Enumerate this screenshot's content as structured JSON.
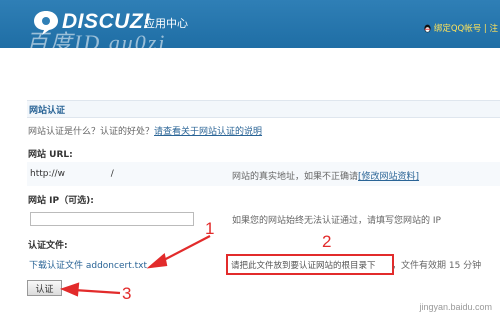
{
  "header": {
    "logo_text": "DISCUZ!",
    "logo_sub": "应用中心",
    "qq_bind": "绑定QQ帐号 | 注",
    "watermark": "百度ID gu0zi",
    "bg_color": "#2f7fb6"
  },
  "section": {
    "title": "网站认证",
    "intro": "网站认证是什么？认证的好处？",
    "intro_link": "请查看关于网站认证的说明"
  },
  "url": {
    "label": "网站 URL:",
    "value": "http://w                /",
    "hint": "网站的真实地址，如果不正确请",
    "hint_link": "[修改网站资料]"
  },
  "ip": {
    "label": "网站 IP（可选):",
    "value": "",
    "hint": "如果您的网站始终无法认证通过，请填写您网站的 IP"
  },
  "file": {
    "label": "认证文件:",
    "download_link": "下载认证文件 addoncert.txt",
    "notice": "请把此文件放到要认证网站的根目录下",
    "validity": "，文件有效期 15 分钟"
  },
  "submit_label": "认证",
  "annotations": [
    "1",
    "2",
    "3"
  ],
  "site_watermark": "jingyan.baidu.com",
  "accent_color": "#e22b2b"
}
